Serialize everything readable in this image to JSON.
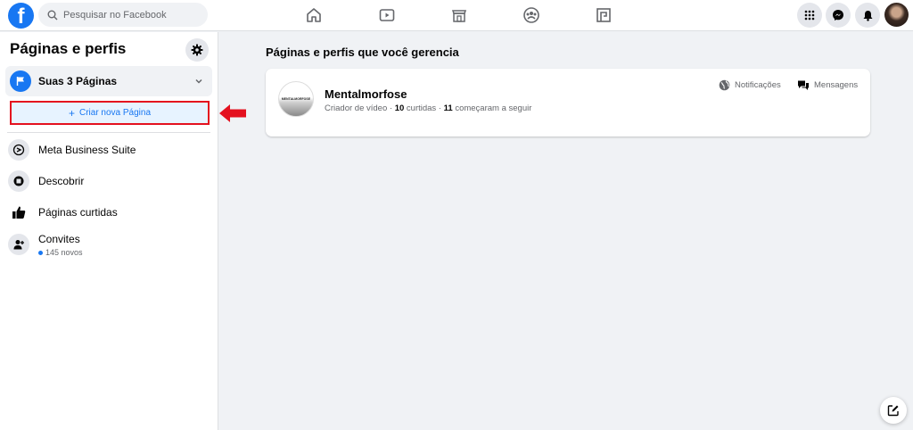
{
  "header": {
    "logo_letter": "f",
    "search_placeholder": "Pesquisar no Facebook",
    "nav": [
      "home-icon",
      "watch-icon",
      "marketplace-icon",
      "groups-icon",
      "gaming-icon"
    ],
    "right": [
      "menu-grid-icon",
      "messenger-icon",
      "notifications-bell-icon",
      "avatar"
    ]
  },
  "sidebar": {
    "title": "Páginas e perfis",
    "pages_dropdown": "Suas 3 Páginas",
    "create_button": "Criar nova Página",
    "items": [
      {
        "label": "Meta Business Suite",
        "icon": "meta-business-icon"
      },
      {
        "label": "Descobrir",
        "icon": "discover-icon"
      },
      {
        "label": "Páginas curtidas",
        "icon": "like-icon"
      },
      {
        "label": "Convites",
        "icon": "invite-icon"
      }
    ],
    "invites_sub": "145 novos"
  },
  "main": {
    "title": "Páginas e perfis que você gerencia",
    "page": {
      "avatar_text": "MENTALMORFOSE",
      "name": "Mentalmorfose",
      "category": "Criador de vídeo",
      "likes_count": "10",
      "likes_label": "curtidas",
      "followers_count": "11",
      "followers_label": "começaram a seguir"
    },
    "actions": {
      "notifications": "Notificações",
      "messages": "Mensagens"
    }
  },
  "colors": {
    "brand": "#1877f2",
    "highlight_red": "#e4111f",
    "background": "#f0f2f5"
  }
}
